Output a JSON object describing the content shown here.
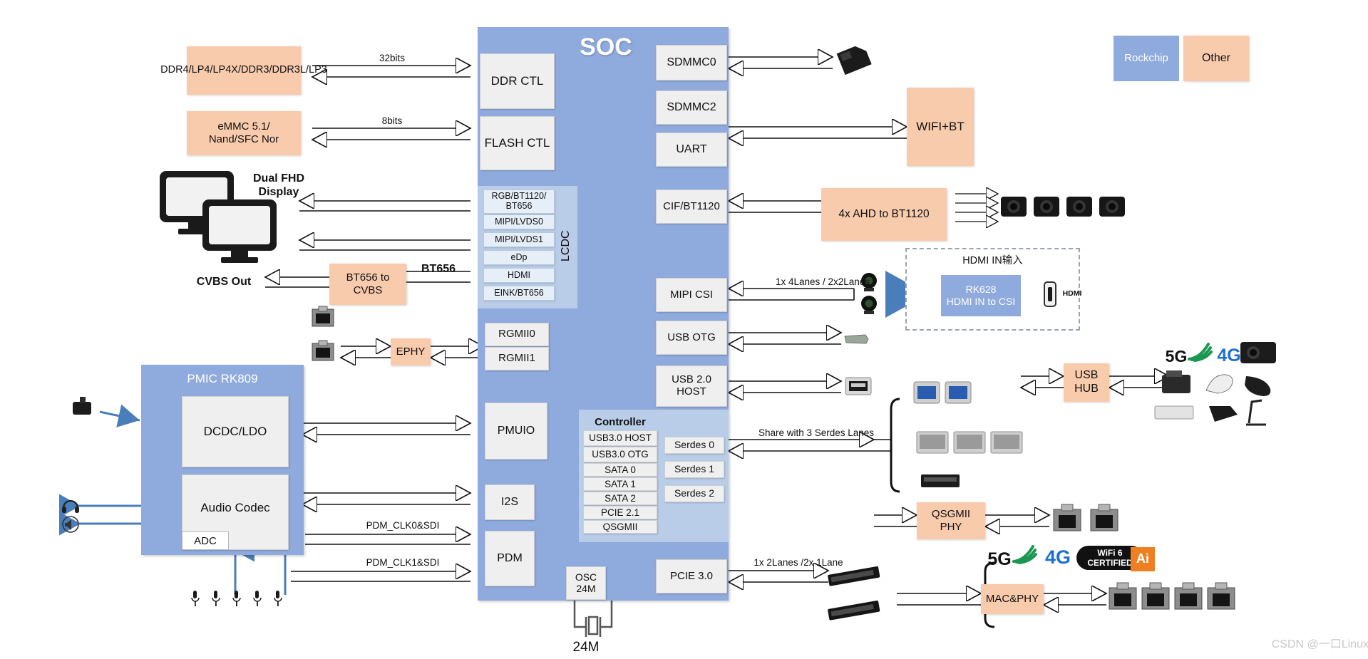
{
  "diagram": {
    "title": "SOC",
    "watermark": "CSDN @一口Linux",
    "colors": {
      "rockchip_blue": "#8faadc",
      "soc_inner_blue": "#b9cde8",
      "other_orange": "#f8cbad",
      "gray_block": "#efefef",
      "arrow_stroke": "#111111",
      "blue_arrow": "#4a7ebb"
    }
  },
  "legend": {
    "items": [
      {
        "label": "Rockchip",
        "color": "#8faadc"
      },
      {
        "label": "Other",
        "color": "#f8cbad"
      }
    ]
  },
  "soc": {
    "title": "SOC",
    "left_blocks": [
      {
        "label": "DDR CTL"
      },
      {
        "label": "FLASH CTL"
      }
    ],
    "lcdc": {
      "label": "LCDC",
      "interfaces": [
        "RGB/BT1120/\nBT656",
        "MIPI/LVDS0",
        "MIPI/LVDS1",
        "eDp",
        "HDMI",
        "EINK/BT656"
      ]
    },
    "rgmii": [
      {
        "label": "RGMII0"
      },
      {
        "label": "RGMII1"
      }
    ],
    "lower_left_blocks": [
      {
        "label": "PMUIO"
      },
      {
        "label": "I2S"
      },
      {
        "label": "PDM"
      }
    ],
    "osc": {
      "label": "OSC\n24M",
      "crystal_label": "24M"
    },
    "controller": {
      "title": "Controller",
      "items": [
        "USB3.0 HOST",
        "USB3.0 OTG",
        "SATA 0",
        "SATA 1",
        "SATA 2",
        "PCIE 2.1",
        "QSGMII"
      ]
    },
    "serdes": [
      "Serdes 0",
      "Serdes 1",
      "Serdes 2"
    ],
    "right_blocks": [
      {
        "label": "SDMMC0"
      },
      {
        "label": "SDMMC2"
      },
      {
        "label": "UART"
      },
      {
        "label": "CIF/BT1120"
      },
      {
        "label": "MIPI CSI"
      },
      {
        "label": "USB OTG"
      },
      {
        "label": "USB 2.0\nHOST"
      },
      {
        "label": "PCIE 3.0"
      }
    ]
  },
  "left_peripherals": {
    "memory": [
      {
        "label": "DDR4/LP4/LP4X/DDR3/DDR3L/LP3",
        "bus": "32bits"
      },
      {
        "label": "eMMC 5.1/\nNand/SFC Nor",
        "bus": "8bits"
      }
    ],
    "display": {
      "monitor_label": "Dual FHD\nDisplay",
      "cvbs_out": "CVBS Out",
      "converter": "BT656 to\nCVBS",
      "bt656_label": "BT656"
    },
    "ephy": {
      "label": "EPHY"
    },
    "pmic": {
      "title": "PMIC RK809",
      "blocks": [
        {
          "label": "DCDC/LDO"
        },
        {
          "label": "Audio Codec"
        },
        {
          "label": "ADC"
        }
      ]
    },
    "pdm_labels": [
      "PDM_CLK0&SDI",
      "PDM_CLK1&SDI"
    ]
  },
  "right_peripherals": {
    "wifi_bt": {
      "label": "WIFI+BT"
    },
    "ahd": {
      "label": "4x AHD to BT1120"
    },
    "hdmi_in": {
      "group_label": "HDMI IN输入",
      "chip_label": "RK628\nHDMI IN to CSI",
      "port_label": "HDMI"
    },
    "usb_hub": {
      "label": "USB\nHUB"
    },
    "qsgmii_phy": {
      "label": "QSGMII\nPHY"
    },
    "mac_phy": {
      "label": "MAC&PHY"
    },
    "badges_top": [
      "5G",
      "4G"
    ],
    "badges_bottom": [
      "5G",
      "4G",
      "WiFi 6 CERTIFIED",
      "Ai"
    ]
  },
  "bus_labels": {
    "mipi_csi": "1x 4Lanes / 2x2Lanes",
    "serdes_share": "Share with 3 Serdes Lanes",
    "pcie3": "1x 2Lanes /2x 1Lane"
  }
}
